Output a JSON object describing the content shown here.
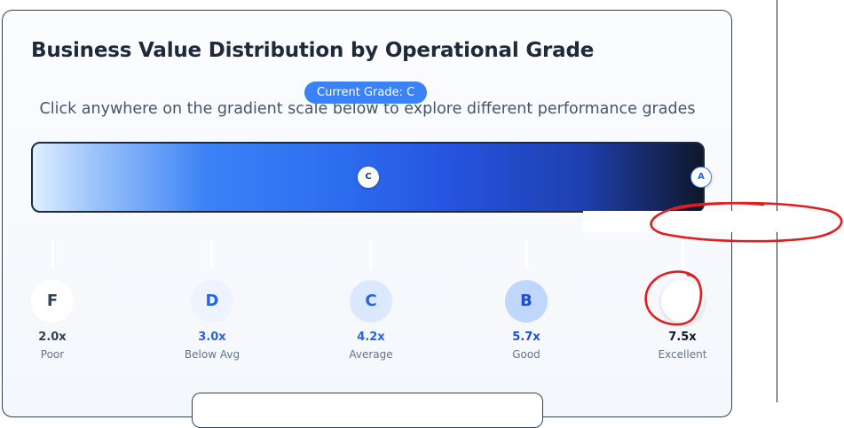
{
  "title": "Business Value Distribution by Operational Grade",
  "current_grade_pill": "Current Grade: C",
  "subtitle": "Click anywhere on the gradient scale below to explore different performance grades",
  "scale": {
    "markers": [
      {
        "letter": "C"
      },
      {
        "letter": "A"
      }
    ]
  },
  "grades": [
    {
      "letter": "F",
      "multiplier": "2.0x",
      "label": "Poor",
      "circle_bg": "#ffffff",
      "circle_fg": "#334155",
      "mult_color": "#334155"
    },
    {
      "letter": "D",
      "multiplier": "3.0x",
      "label": "Below Avg",
      "circle_bg": "#eef4ff",
      "circle_fg": "#2563eb",
      "mult_color": "#2563eb"
    },
    {
      "letter": "C",
      "multiplier": "4.2x",
      "label": "Average",
      "circle_bg": "#dbe8fe",
      "circle_fg": "#2563eb",
      "mult_color": "#2563eb"
    },
    {
      "letter": "B",
      "multiplier": "5.7x",
      "label": "Good",
      "circle_bg": "#bfd7fd",
      "circle_fg": "#1d4ed8",
      "mult_color": "#1d4ed8"
    },
    {
      "letter": "",
      "multiplier": "7.5x",
      "label": "Excellent",
      "circle_bg": "#ffffff",
      "circle_fg": "#1e3a8a",
      "mult_color": "#0f172a"
    }
  ],
  "colors": {
    "accent": "#3b82f6",
    "title": "#1e293b",
    "annotation": "#e11d1d"
  }
}
